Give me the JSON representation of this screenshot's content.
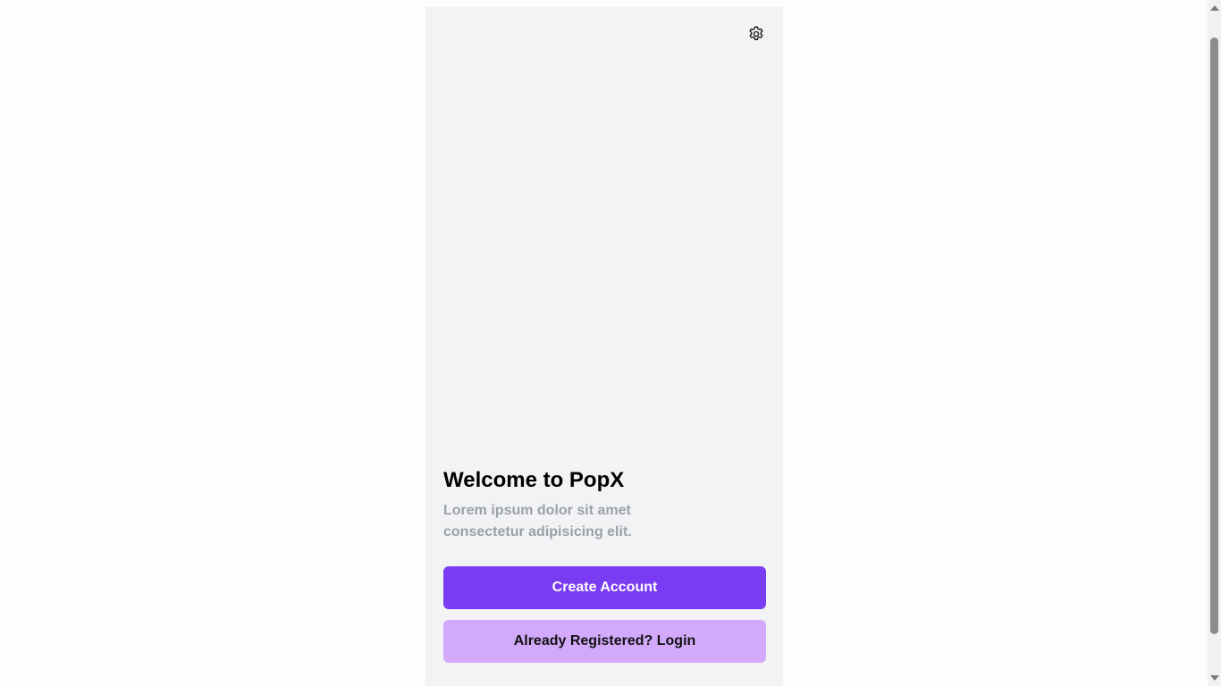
{
  "header": {
    "settings_icon": "gear-icon"
  },
  "landing": {
    "title": "Welcome to PopX",
    "subtitle_line1": "Lorem ipsum dolor sit amet",
    "subtitle_line2": "consectetur adipisicing elit.",
    "create_account_label": "Create Account",
    "login_label": "Already Registered? Login"
  },
  "colors": {
    "primary": "#7a3cf2",
    "secondary": "#d3a9fb",
    "panel_bg": "#f2f3f5",
    "subtitle": "#9ca0a8"
  }
}
